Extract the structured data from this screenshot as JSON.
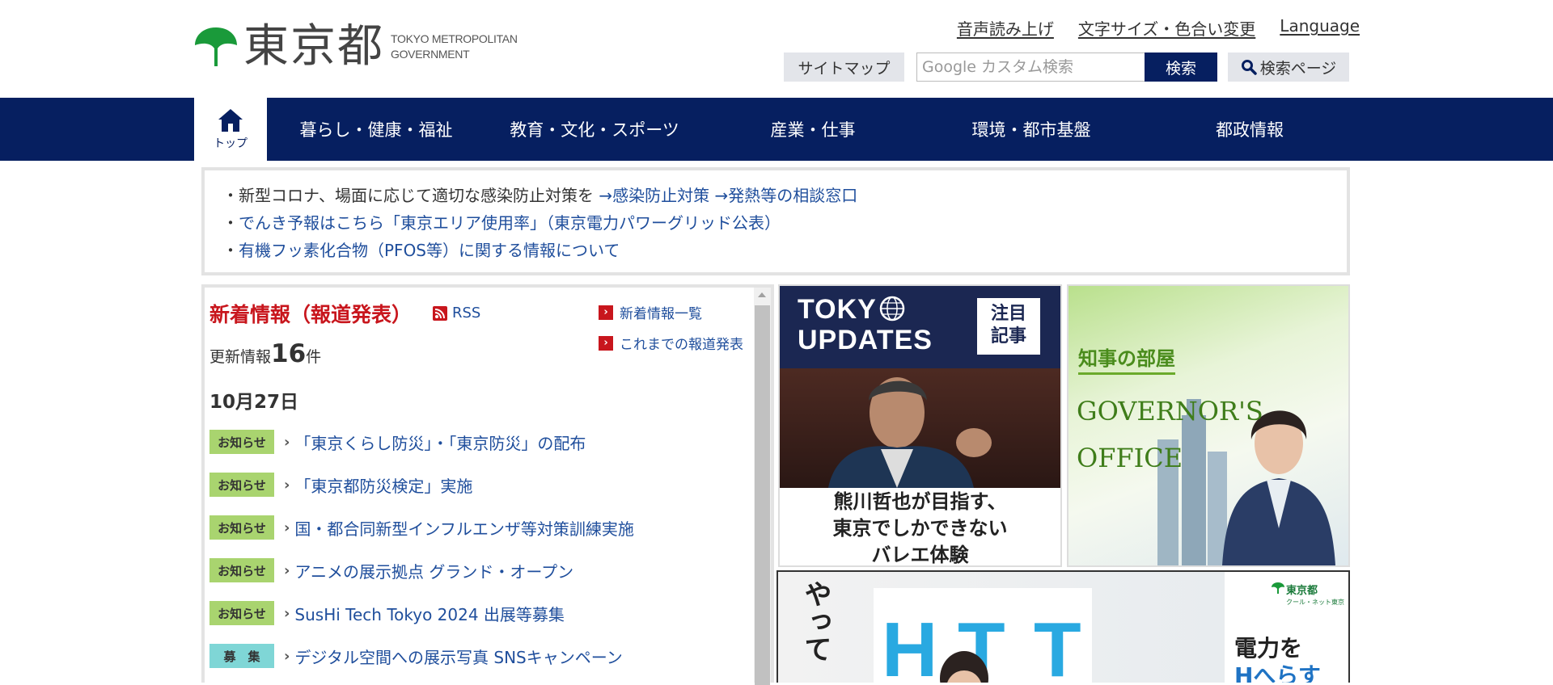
{
  "header": {
    "logo_ja": "東京都",
    "logo_en_line1": "TOKYO METROPOLITAN",
    "logo_en_line2": "GOVERNMENT",
    "util_links": [
      "音声読み上げ",
      "文字サイズ・色合い変更",
      "Language"
    ],
    "sitemap_label": "サイトマップ",
    "search_placeholder": "Google カスタム検索",
    "search_button": "検索",
    "search_page_label": "検索ページ"
  },
  "nav": {
    "home_label": "トップ",
    "items": [
      "暮らし・健康・福祉",
      "教育・文化・スポーツ",
      "産業・仕事",
      "環境・都市基盤",
      "都政情報"
    ]
  },
  "notice": {
    "line1_text": "・新型コロナ、場面に応じて適切な感染防止対策を",
    "line1_link1": "→感染防止対策",
    "line1_link2": "→発熱等の相談窓口",
    "line2_bullet": "・",
    "line2_link": "でんき予報はこちら「東京エリア使用率」（東京電力パワーグリッド公表）",
    "line3_bullet": "・",
    "line3_link": "有機フッ素化合物（PFOS等）に関する情報について"
  },
  "news": {
    "title": "新着情報（報道発表）",
    "rss_label": "RSS",
    "list_link": "新着情報一覧",
    "archive_link": "これまでの報道発表",
    "update_prefix": "更新情報",
    "update_count": "16",
    "update_suffix": "件",
    "date": "10月27日",
    "items": [
      {
        "badge": "お知らせ",
        "badge_color": "#a9d46f",
        "title": "「東京くらし防災」・「東京防災」の配布"
      },
      {
        "badge": "お知らせ",
        "badge_color": "#a9d46f",
        "title": "「東京都防災検定」実施"
      },
      {
        "badge": "お知らせ",
        "badge_color": "#a9d46f",
        "title": "国・都合同新型インフルエンザ等対策訓練実施"
      },
      {
        "badge": "お知らせ",
        "badge_color": "#a9d46f",
        "title": "アニメの展示拠点 グランド・オープン"
      },
      {
        "badge": "お知らせ",
        "badge_color": "#a9d46f",
        "title": "SusHi Tech Tokyo 2024 出展等募集"
      },
      {
        "badge": "募　集",
        "badge_color": "#7fd6d6",
        "title": "デジタル空間への展示写真 SNSキャンペーン"
      }
    ]
  },
  "banners": {
    "updates": {
      "logo_line1": "TOKY",
      "logo_line2": "UPDATES",
      "badge": "注目\n記事",
      "caption_line1": "熊川哲也が目指す、",
      "caption_line2": "東京でしかできない",
      "caption_line3": "バレエ体験"
    },
    "governor": {
      "room_label": "知事の部屋",
      "en_line1": "GOVERNOR'S",
      "en_line2": "OFFICE"
    },
    "power": {
      "vertical_text": "やって",
      "curtain_letters": [
        "H",
        "T",
        "T"
      ],
      "org": "東京都",
      "org_sub": "クール・ネット東京",
      "headline_line1": "電力を",
      "headline_line2": "Hへらす"
    }
  },
  "colors": {
    "nav_bg": "#061f60",
    "accent_red": "#c8161d",
    "link_blue": "#1f4e9c",
    "logo_green": "#1a9a3a"
  }
}
